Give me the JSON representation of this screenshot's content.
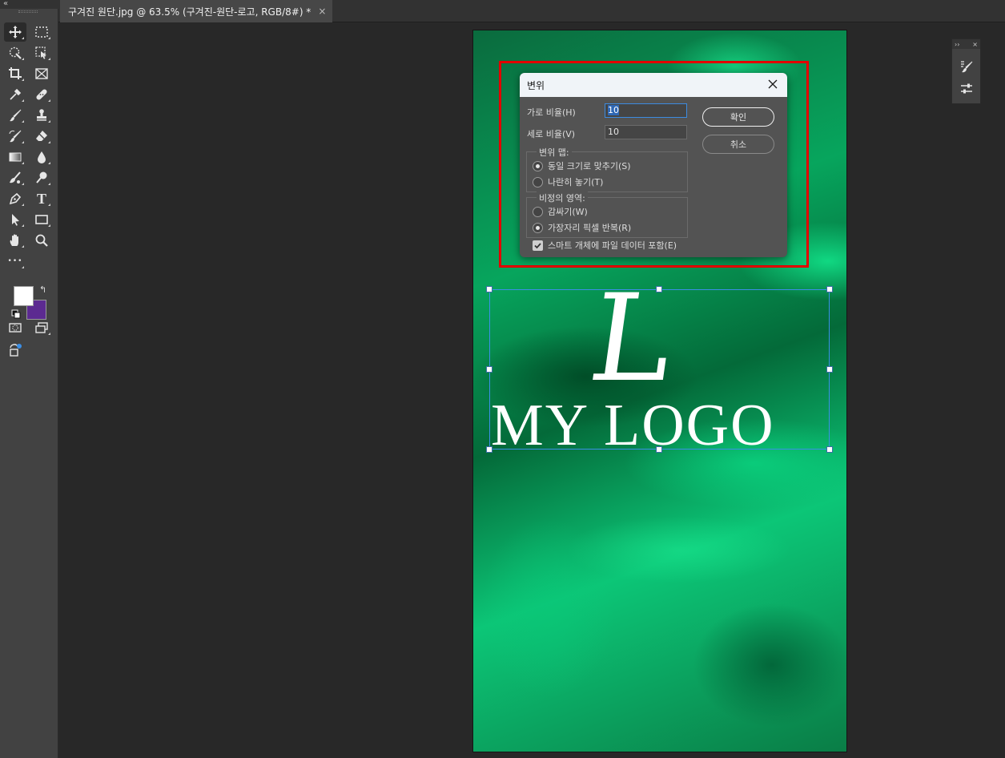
{
  "tab": {
    "collapse_glyph": "«",
    "document_title": "구겨진 원단.jpg @ 63.5% (구겨진-원단-로고, RGB/8#) *",
    "close_glyph": "×"
  },
  "toolbar": {
    "tools": [
      "move-tool",
      "rectangular-marquee-tool",
      "quick-selection-tool",
      "object-selection-tool",
      "crop-tool",
      "frame-tool",
      "eyedropper-tool",
      "spot-healing-brush-tool",
      "brush-tool",
      "clone-stamp-tool",
      "history-brush-tool",
      "eraser-tool",
      "gradient-tool",
      "blur-tool",
      "smudge-tool",
      "dodge-tool",
      "pen-tool",
      "type-tool",
      "path-selection-tool",
      "rectangle-tool",
      "hand-tool",
      "zoom-tool",
      "edit-toolbar",
      "quick-mask",
      "screen-mode",
      "generative-fill"
    ],
    "type_glyph": "T",
    "more_glyph": "•••",
    "swap_glyph": "↰",
    "foreground_color": "#ffffff",
    "background_color": "#5c2a91"
  },
  "canvas": {
    "logo_letter": "L",
    "logo_text": "MY LOGO"
  },
  "dialog": {
    "title": "변위",
    "horizontal_scale_label": "가로 비율(H)",
    "horizontal_scale_value": "10",
    "vertical_scale_label": "세로 비율(V)",
    "vertical_scale_value": "10",
    "ok_label": "확인",
    "cancel_label": "취소",
    "displacement_map": {
      "legend": "변위 맵:",
      "options": [
        "동일 크기로 맞추기(S)",
        "나란히 놓기(T)"
      ],
      "selected": 0
    },
    "undefined_areas": {
      "legend": "비정의 영역:",
      "options": [
        "감싸기(W)",
        "가장자리 픽셀 반복(R)"
      ],
      "selected": 1
    },
    "embed_checkbox_label": "스마트 개체에 파일 데이터 포함(E)",
    "embed_checked": true
  },
  "mini_panel": {
    "collapse_glyph": "››",
    "close_glyph": "×",
    "buttons": [
      "brush-settings",
      "adjustments"
    ]
  }
}
